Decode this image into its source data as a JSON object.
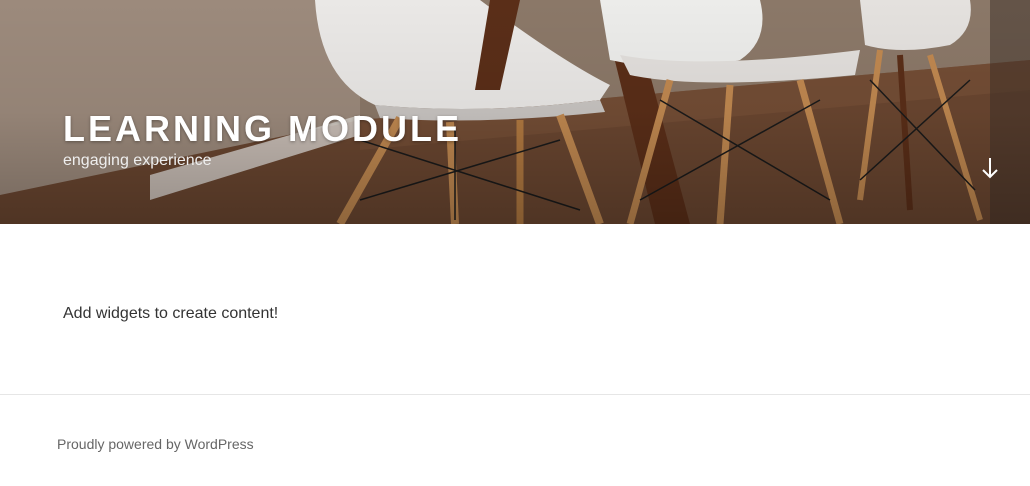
{
  "header": {
    "site_title": "LEARNING MODULE",
    "site_description": "engaging experience",
    "scroll_icon": "arrow-down-icon"
  },
  "main": {
    "widget_text": "Add widgets to create content!"
  },
  "footer": {
    "credit": "Proudly powered by WordPress"
  },
  "colors": {
    "title": "#ffffff",
    "body_text": "#333333",
    "footer_text": "#666666",
    "footer_border": "#e6e6e6"
  }
}
